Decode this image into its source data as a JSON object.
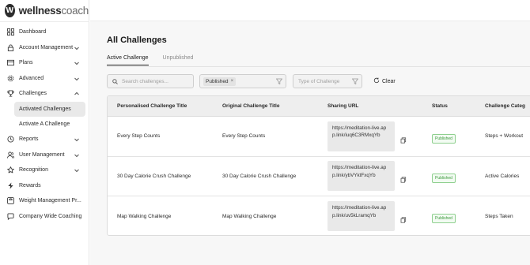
{
  "brand": {
    "mark": "W",
    "name_bold": "wellness",
    "name_light": "coach"
  },
  "sidebar": {
    "items": [
      {
        "label": "Dashboard",
        "icon": "grid-icon",
        "has_chevron": false
      },
      {
        "label": "Account Management",
        "icon": "lock-icon",
        "has_chevron": true
      },
      {
        "label": "Plans",
        "icon": "card-icon",
        "has_chevron": true
      },
      {
        "label": "Advanced",
        "icon": "gear-icon",
        "has_chevron": true
      },
      {
        "label": "Challenges",
        "icon": "trophy-icon",
        "has_chevron": true,
        "expanded": true
      }
    ],
    "challenge_subitems": [
      {
        "label": "Activated Challenges",
        "active": true
      },
      {
        "label": "Activate A Challenge",
        "active": false
      }
    ],
    "items_after": [
      {
        "label": "Reports",
        "icon": "clock-icon",
        "has_chevron": true
      },
      {
        "label": "User Management",
        "icon": "users-icon",
        "has_chevron": true
      },
      {
        "label": "Recognition",
        "icon": "star-icon",
        "has_chevron": true
      },
      {
        "label": "Rewards",
        "icon": "bolt-icon",
        "has_chevron": false
      },
      {
        "label": "Weight Management Pr...",
        "icon": "scale-icon",
        "has_chevron": false
      },
      {
        "label": "Company Wide Coaching",
        "icon": "chat-icon",
        "has_chevron": false
      }
    ]
  },
  "main": {
    "title": "All Challenges",
    "tabs": [
      {
        "label": "Active Challenge",
        "active": true
      },
      {
        "label": "Unpublished",
        "active": false
      }
    ],
    "filters": {
      "search_placeholder": "Search challenges...",
      "status_chip": "Published",
      "type_placeholder": "Type of Challenge",
      "clear_label": "Clear"
    },
    "table": {
      "headers": [
        "Personalised Challenge Title",
        "Original Challenge Title",
        "Sharing URL",
        "Status",
        "Challenge Categ"
      ],
      "rows": [
        {
          "personalised": "Every Step Counts",
          "original": "Every Step Counts",
          "url": "https://meditation-live.app.link/iuq6C3RMxqYb",
          "status": "Published",
          "category": "Steps + Workout"
        },
        {
          "personalised": "30 Day Calorie Crush Challenge",
          "original": "30 Day Calorie Crush Challenge",
          "url": "https://meditation-live.app.link/ybVYktFxqYb",
          "status": "Published",
          "category": "Active Calories"
        },
        {
          "personalised": "Map Walking Challenge",
          "original": "Map Walking Challenge",
          "url": "https://meditation-live.app.link/uv5kLramqYb",
          "status": "Published",
          "category": "Steps Taken"
        }
      ]
    }
  }
}
